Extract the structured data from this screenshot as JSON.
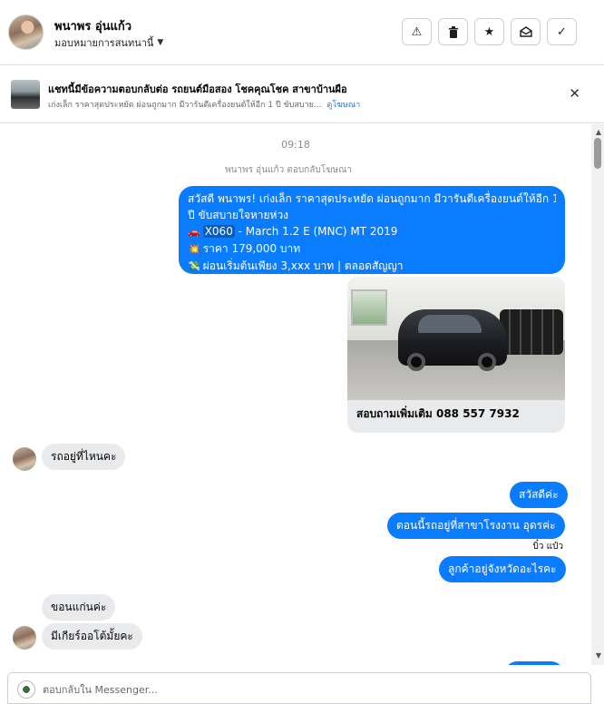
{
  "header": {
    "contact_name": "พนาพร อุ่นแก้ว",
    "assign_label": "มอบหมายการสนทนานี้",
    "action_icons": [
      "warning-icon",
      "trash-icon",
      "star-icon",
      "mark-unread-icon",
      "done-check-icon"
    ]
  },
  "ad_banner": {
    "title": "แชทนี้มีข้อความตอบกลับต่อ รถยนต์มือสอง โชคคุณโชค สาขาบ้านผือ",
    "subtitle": "เก่งเล็ก ราคาสุดประหยัด ผ่อนถูกมาก มีวารันตีเครื่องยนต์ให้อีก 1 ปี ขับสบาย...",
    "link": "ดูโฆษณา"
  },
  "chat": {
    "time": "09:18",
    "replied_to_ad": "พนาพร อุ่นแก้ว ตอบกลับโฆษณา",
    "ad_message": {
      "line1": "สวัสดี พนาพร! เก่งเล็ก ราคาสุดประหยัด ผ่อนถูกมาก มีวารันตีเครื่องยนต์ให้อีก 1",
      "line2": "ปี ขับสบายใจหายห่วง",
      "code": "X060",
      "model": " - March 1.2 E (MNC) MT 2019",
      "price": "ราคา 179,000 บาท",
      "installment": "ผ่อนเริ่มต้นเพียง 3,xxx บาท | ตลอดสัญญา",
      "icons": [
        "car-icon",
        "burst-icon",
        "money-icon"
      ]
    },
    "card_caption": "สอบถามเพิ่มเติม 088 557 7932",
    "incoming_1": "รถอยู่ที่ไหนคะ",
    "outgoing_1": "สวัสดีค่ะ",
    "outgoing_2": "ตอนนี้รถอยู่ที่สาขาโรงงาน  อุดรค่ะ",
    "seen_by": "บิ๋ว แป๋ว",
    "outgoing_3": "ลูกค้าอยู่จังหวัดอะไรคะ",
    "incoming_2": "ขอนแก่นค่ะ",
    "incoming_3": "มีเกียร์ออโต้มั้ยคะ"
  },
  "composer": {
    "placeholder": "ตอบกลับใน Messenger..."
  },
  "colors": {
    "outgoing_bubble": "#0a7cff",
    "incoming_bubble": "#e9eaec",
    "link": "#1877f2"
  }
}
